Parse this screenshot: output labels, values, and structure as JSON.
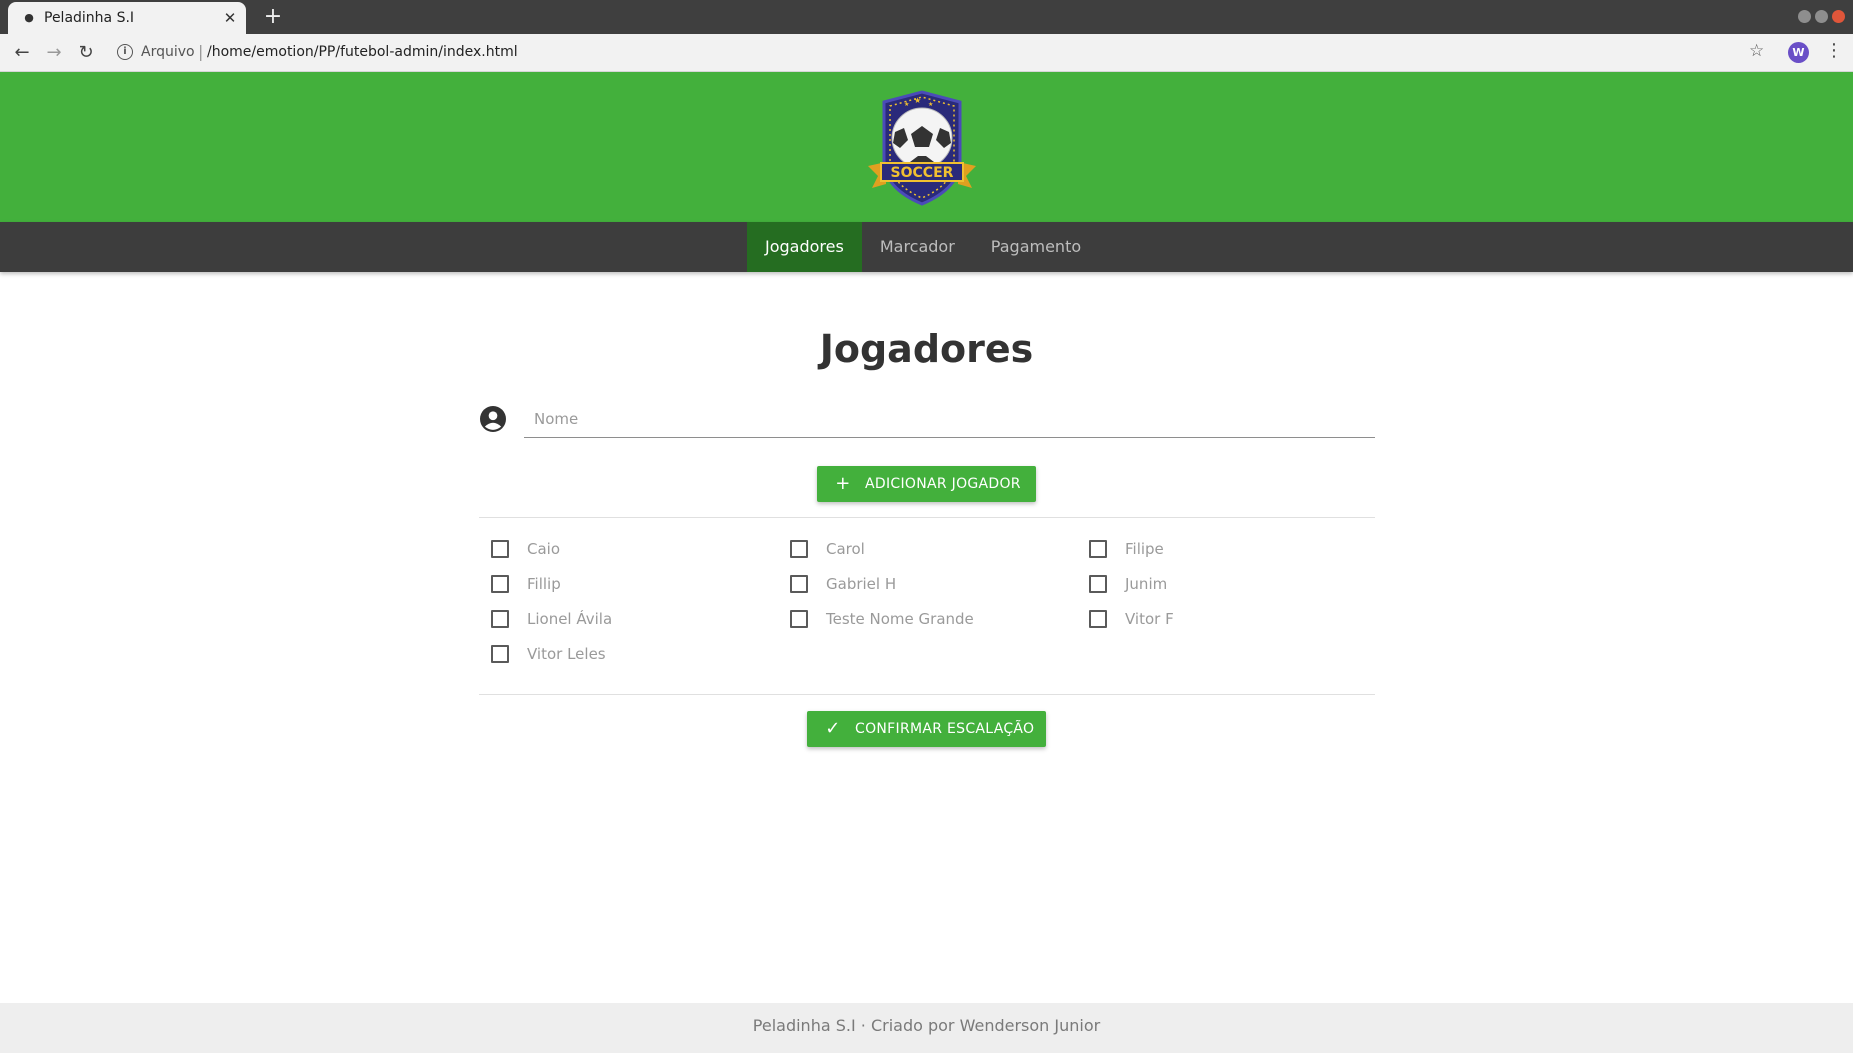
{
  "browser": {
    "tab_title": "Peladinha S.I",
    "address_protocol": "Arquivo",
    "address_url": "/home/emotion/PP/futebol-admin/index.html",
    "profile_initial": "W"
  },
  "header": {
    "logo_text": "SOCCER"
  },
  "nav": {
    "items": [
      {
        "label": "Jogadores",
        "active": true
      },
      {
        "label": "Marcador",
        "active": false
      },
      {
        "label": "Pagamento",
        "active": false
      }
    ]
  },
  "main": {
    "title": "Jogadores",
    "name_input": {
      "placeholder": "Nome",
      "value": ""
    },
    "add_button_label": "ADICIONAR JOGADOR",
    "players": [
      {
        "name": "Caio",
        "checked": false
      },
      {
        "name": "Carol",
        "checked": false
      },
      {
        "name": "Filipe",
        "checked": false
      },
      {
        "name": "Fillip",
        "checked": false
      },
      {
        "name": "Gabriel H",
        "checked": false
      },
      {
        "name": "Junim",
        "checked": false
      },
      {
        "name": "Lionel Ávila",
        "checked": false
      },
      {
        "name": "Teste Nome Grande",
        "checked": false
      },
      {
        "name": "Vitor F",
        "checked": false
      },
      {
        "name": "Vitor Leles",
        "checked": false
      }
    ],
    "confirm_button_label": "CONFIRMAR ESCALAÇÃO"
  },
  "footer": {
    "text": "Peladinha S.I · Criado por Wenderson Junior"
  },
  "colors": {
    "header_green": "#43b03c",
    "nav_dark": "#3d3d3d",
    "nav_active": "#256d21",
    "button_green": "#43b03c"
  }
}
